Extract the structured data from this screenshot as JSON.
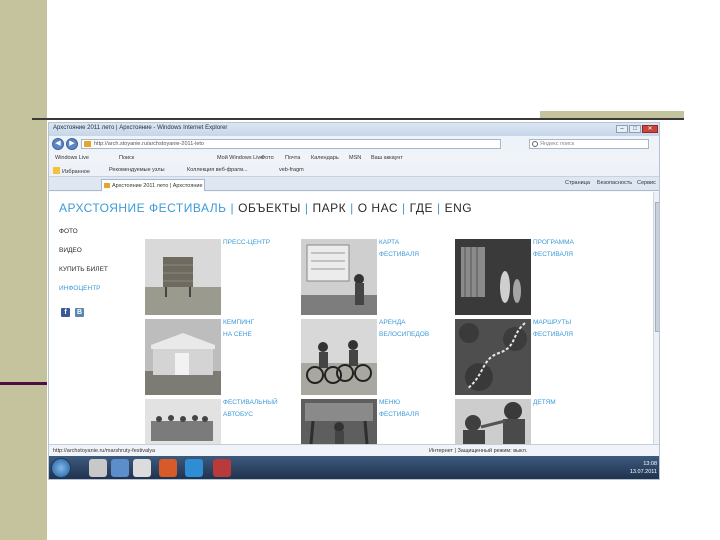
{
  "browser": {
    "window_title": "Архстояние 2011 лето | Архстояние - Windows Internet Explorer",
    "address": "http://arch.stoyanie.ru/archstoyanie-2011-leto",
    "search_placeholder": "Яндекс поиск",
    "menu_items": [
      "Windows Live",
      "Поиск",
      "Мой Windows Live",
      "Фото",
      "Почта",
      "Календарь",
      "МSN",
      "Ваш аккаунт"
    ],
    "favorites_label": "Избранное",
    "favorites_items": [
      "Рекомендуемые узлы",
      "Коллекция веб-фрагм...",
      "veb-fragm"
    ],
    "tab_label": "Архстояние 2011 лето | Архстояние",
    "command_items": [
      "Страница",
      "Безопасность",
      "Сервис"
    ],
    "status_url": "http://archstoyanie.ru/marshruty-festivalya",
    "status_zone": "Интернет | Защищенный режим: выкл.",
    "tray_time": "13:08",
    "tray_date": "13.07.2011"
  },
  "site": {
    "nav": [
      "АРХСТОЯНИЕ ФЕСТИВАЛЬ",
      "ОБЪЕКТЫ",
      "ПАРК",
      "О НАС",
      "ГДЕ",
      "ENG"
    ],
    "left_menu": [
      "ФОТО",
      "ВИДЕО",
      "КУПИТЬ БИЛЕТ",
      "ИНФОЦЕНТР"
    ],
    "social": [
      "f",
      "B"
    ],
    "tiles": [
      {
        "label": "ПРЕСС-ЦЕНТР"
      },
      {
        "label": "КАРТА\nФЕСТИВАЛЯ"
      },
      {
        "label": "ПРОГРАММА\nФЕСТИВАЛЯ"
      },
      {
        "label": "КЕМПИНГ\nНА СЕНЕ"
      },
      {
        "label": "АРЕНДА\nВЕЛОСИПЕДОВ"
      },
      {
        "label": "МАРШРУТЫ\nФЕСТИВАЛЯ"
      },
      {
        "label": "ФЕСТИВАЛЬНЫЙ\nАВТОБУС"
      },
      {
        "label": "МЕНЮ\nФЕСТИВАЛЯ"
      },
      {
        "label": "ДЕТЯМ"
      }
    ]
  }
}
